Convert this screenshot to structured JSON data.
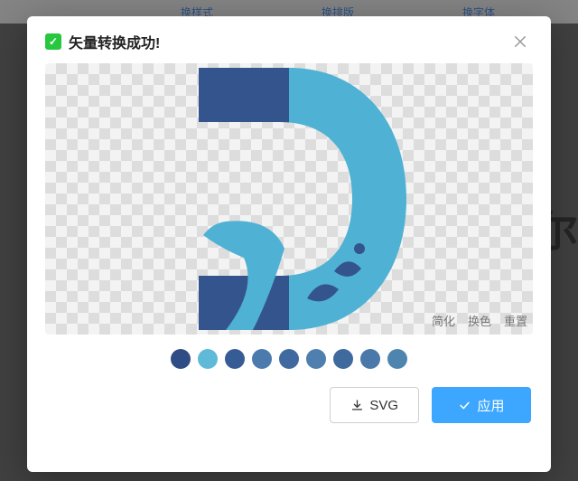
{
  "background": {
    "tab1": "换样式",
    "tab2": "换排版",
    "tab3": "换字体",
    "rightGlyph": "尔"
  },
  "modal": {
    "title": "矢量转换成功!",
    "tools": {
      "simplify": "简化",
      "recolor": "换色",
      "reset": "重置"
    },
    "swatches": [
      "#2f4d84",
      "#5fb9d9",
      "#375b94",
      "#4b7aad",
      "#406a9f",
      "#4f7fae",
      "#3f6a9d",
      "#4a79a9",
      "#4e85af"
    ],
    "buttons": {
      "svg": "SVG",
      "apply": "应用"
    }
  },
  "logo": {
    "leftColor": "#34548d",
    "rightColor": "#4fb1d3"
  }
}
